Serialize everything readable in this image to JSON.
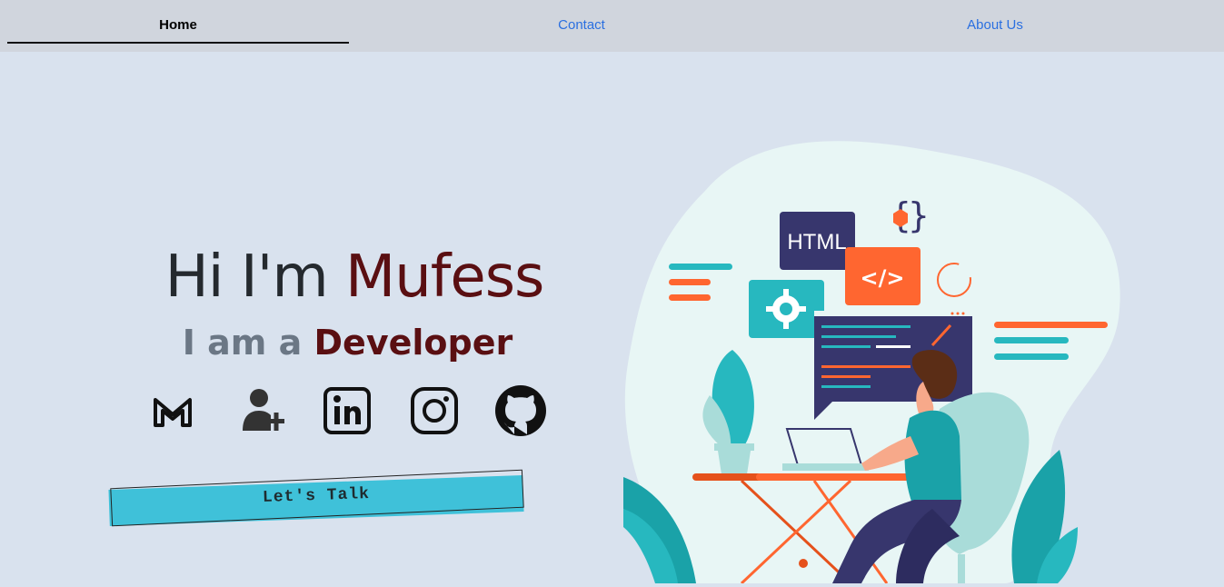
{
  "nav": {
    "home": "Home",
    "contact": "Contact",
    "about": "About Us"
  },
  "hero": {
    "greeting": "Hi I'm ",
    "name": "Mufess",
    "subtitle_prefix": "I am a ",
    "role": "Developer"
  },
  "social": [
    "gmail-icon",
    "add-contact-icon",
    "linkedin-icon",
    "instagram-icon",
    "github-icon"
  ],
  "cta": {
    "label": "Let's Talk"
  },
  "illustration": {
    "html_label": "HTML",
    "code_label": "</>"
  },
  "colors": {
    "accent": "#5a0f12",
    "link": "#2a6fe0",
    "cta": "#3fc1d9",
    "teal": "#27b8bf",
    "orange": "#ff6630",
    "navy": "#37366d"
  }
}
